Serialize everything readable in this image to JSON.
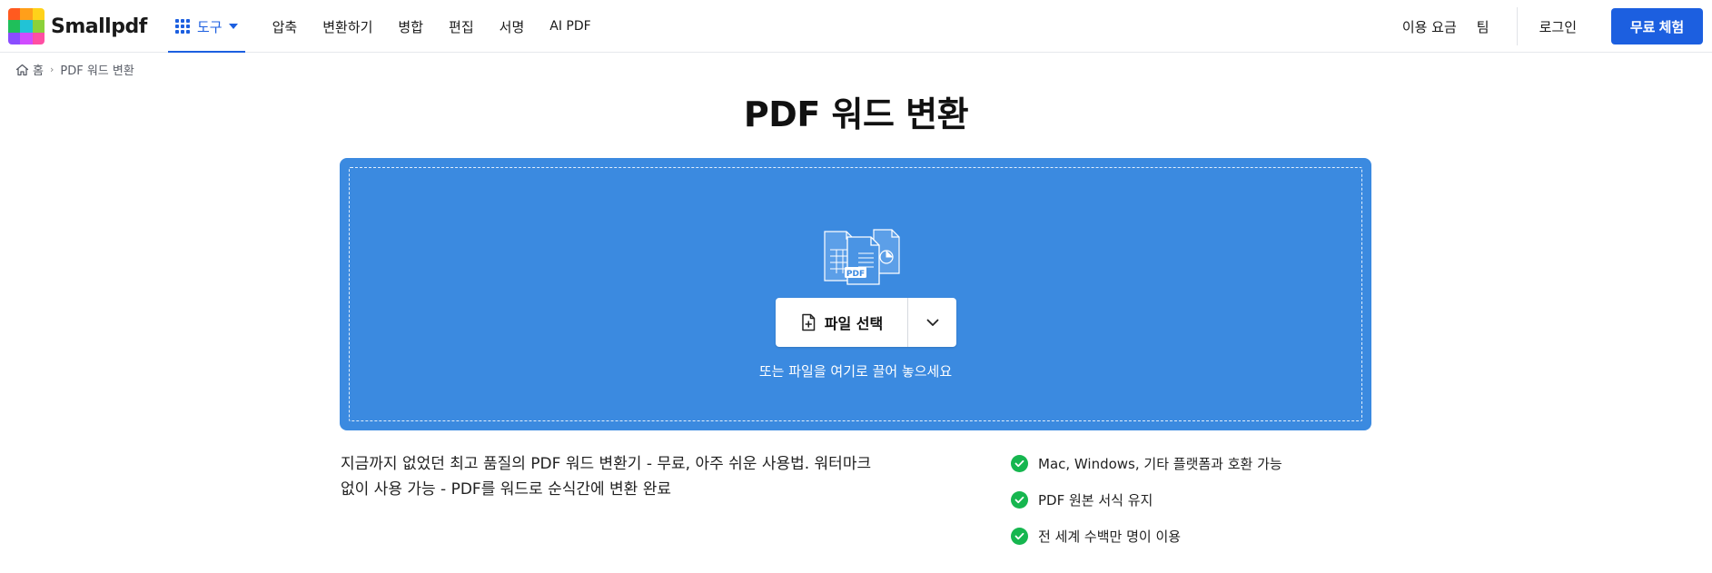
{
  "header": {
    "logo_text": "Smallpdf",
    "logo_colors": [
      "#ff5a1f",
      "#ff9f1a",
      "#ffd21a",
      "#1fbf5a",
      "#21c3d6",
      "#8a4dff",
      "#2f8cff",
      "#d04cff",
      "#ff4fa3"
    ],
    "nav": {
      "tools_label": "도구",
      "items": [
        "압축",
        "변환하기",
        "병합",
        "편집",
        "서명",
        "AI PDF"
      ]
    },
    "right": {
      "pricing": "이용 요금",
      "team": "팀",
      "login": "로그인",
      "trial": "무료 체험"
    }
  },
  "breadcrumb": {
    "home": "홈",
    "current": "PDF 워드 변환"
  },
  "page_title": "PDF 워드 변환",
  "dropzone": {
    "color": "#3b8ae0",
    "illustration_label": "PDF",
    "button_label": "파일 선택",
    "hint": "또는 파일을 여기로 끌어 놓으세요"
  },
  "description": {
    "line1": "지금까지 없었던 최고 품질의 PDF 워드 변환기 - 무료, 아주 쉬운 사용법. 워터마크",
    "line2": "없이 사용 가능 - PDF를 워드로 순식간에 변환 완료"
  },
  "features": [
    "Mac, Windows, 기타 플랫폼과 호환 가능",
    "PDF 원본 서식 유지",
    "전 세계 수백만 명이 이용"
  ],
  "colors": {
    "accent": "#1c5fe0",
    "check": "#16b64f"
  }
}
